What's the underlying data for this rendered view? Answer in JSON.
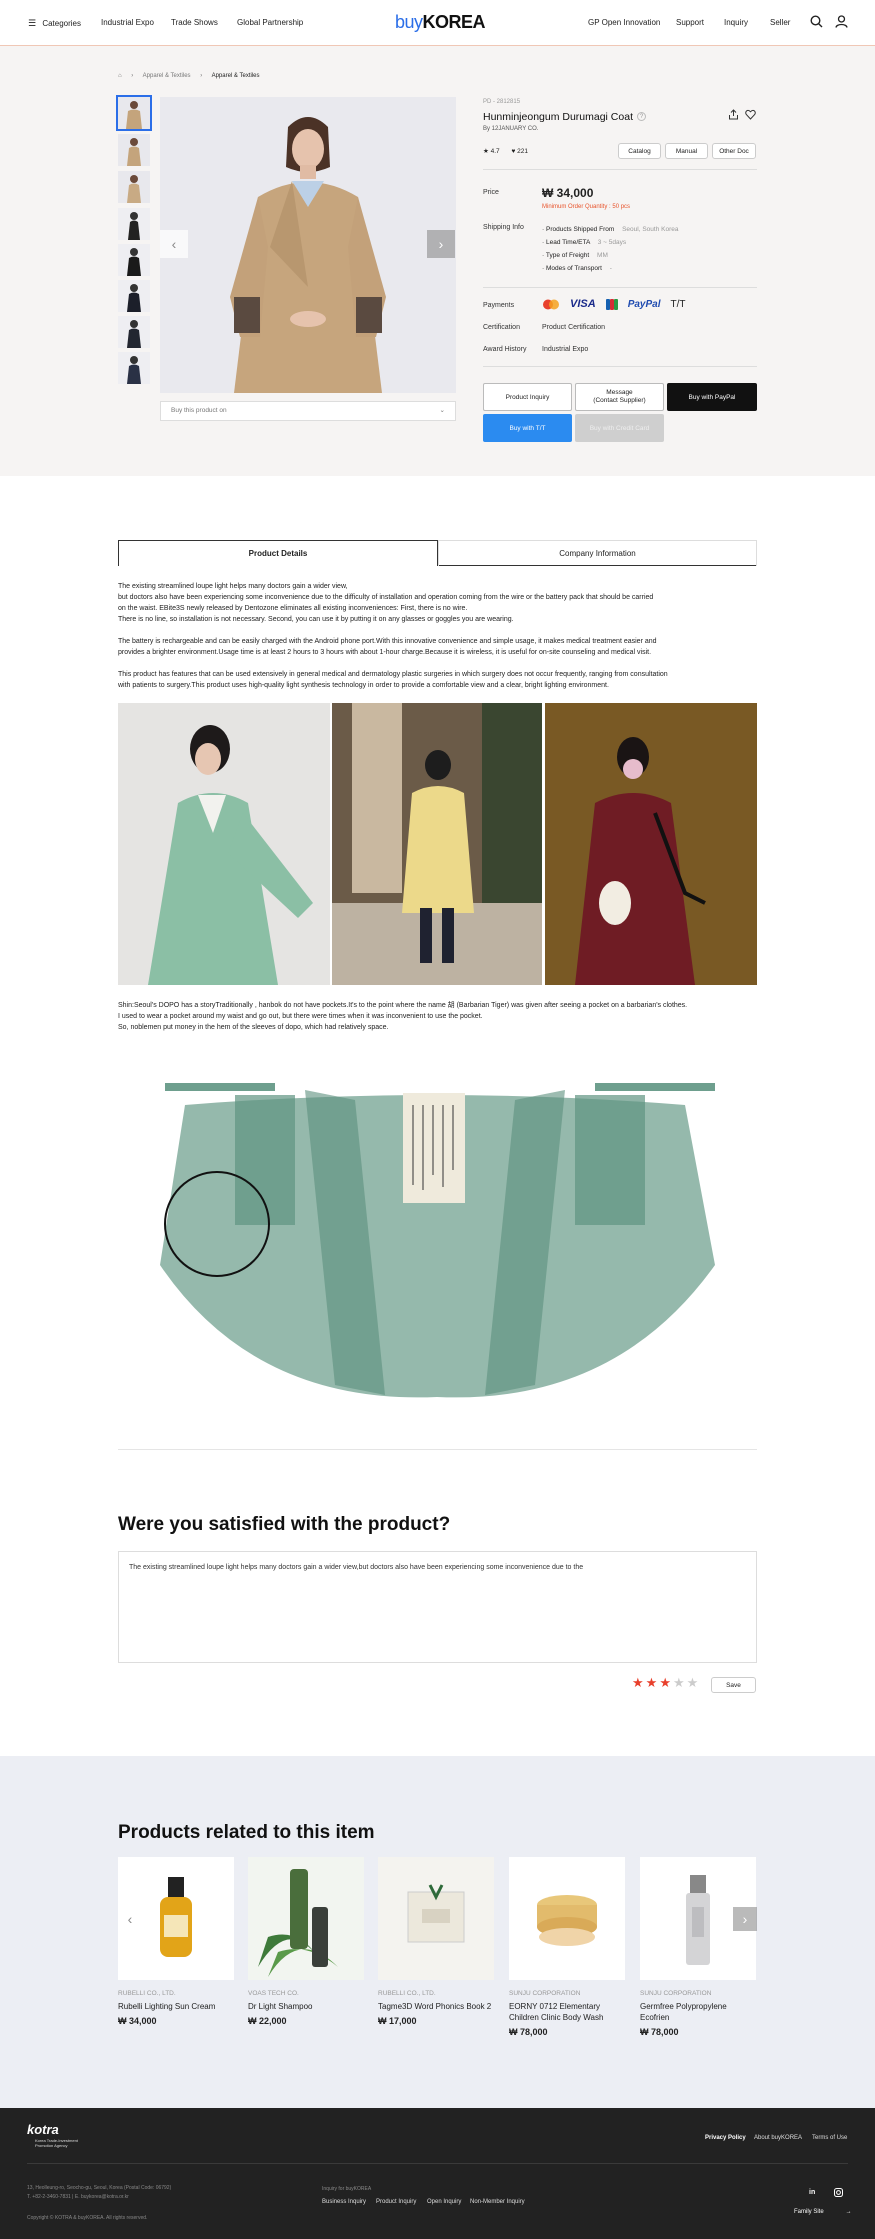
{
  "header": {
    "categories": "Categories",
    "nav": [
      "Industrial Expo",
      "Trade Shows",
      "Global Partnership"
    ],
    "logo_buy": "buy",
    "logo_korea": "KOREA",
    "right_nav": [
      "GP Open Innovation",
      "Support",
      "Inquiry",
      "Seller"
    ]
  },
  "breadcrumb": [
    "Apparel & Textiles",
    "Apparel & Textiles"
  ],
  "product": {
    "pid": "PD - 2812815",
    "name": "Hunminjeongum Durumagi Coat",
    "by": "By 12JANUARY CO.",
    "rating": "4.7",
    "likes": "221",
    "doc_buttons": [
      "Catalog",
      "Manual",
      "Other Doc"
    ],
    "price_label": "Price",
    "price": "₩ 34,000",
    "moq": "Minimum Order Quantity : 50 pcs",
    "shipping_label": "Shipping Info",
    "shipping": [
      {
        "k": "Products Shipped From",
        "v": "Seoul, South Korea"
      },
      {
        "k": "Lead Time/ETA",
        "v": "3 ~ 5days"
      },
      {
        "k": "Type of Freight",
        "v": "MM"
      },
      {
        "k": "Modes of Transport",
        "v": "-"
      }
    ],
    "payments_label": "Payments",
    "payments": {
      "visa": "VISA",
      "paypal": "PayPal",
      "tt": "T/T"
    },
    "cert_label": "Certification",
    "cert": "Product Certification",
    "award_label": "Award History",
    "award": "Industrial Expo",
    "buy_select": "Buy this product on",
    "actions": {
      "inquiry": "Product Inquiry",
      "message": "Message\n(Contact Supplier)",
      "paypal": "Buy with PayPal",
      "tt": "Buy with T/T",
      "card": "Buy with Credit Card"
    }
  },
  "tabs": [
    "Product Details",
    "Company Information"
  ],
  "description": {
    "p1": "The existing streamlined loupe light helps many doctors gain a wider view,\nbut doctors also have been experiencing some inconvenience due to the difficulty of installation and operation coming from the wire or the battery pack that should be carried\non the waist. EBite3S newly released by Dentozone eliminates all existing inconveniences: First, there is no wire.\nThere is no line, so installation is not necessary. Second, you can use it by putting it on any glasses or goggles you are wearing.",
    "p2": "The battery is rechargeable and can be easily charged with the Android phone port.With this innovative convenience and simple usage, it makes medical treatment easier and\nprovides a brighter environment.Usage time is at least 2 hours to 3 hours with about 1-hour charge.Because it is wireless, it is useful for on-site counseling and medical visit.",
    "p3": "This product has features that can be used extensively in general medical and dermatology plastic surgeries in which surgery does not occur frequently, ranging from consultation\nwith patients to surgery.This product uses high-quality light synthesis technology in order to provide a comfortable view and a clear, bright lighting environment.",
    "p4": "Shin:Seoul's DOPO has a storyTraditionally , hanbok do not have pockets.It's to the point where the name 胡 (Barbarian Tiger) was given after seeing a pocket on a barbarian's clothes.\nI used to wear a pocket around my waist and go out, but there were times when it was inconvenient to use the pocket.\nSo, noblemen put money in the hem of the sleeves of dopo, which had relatively space."
  },
  "review": {
    "title": "Were you satisfied with the product?",
    "text": "The existing streamlined loupe light helps many doctors gain a wider view,but doctors also have been experiencing some inconvenience due to the",
    "stars": 3,
    "save": "Save"
  },
  "related": {
    "title": "Products related to this item",
    "items": [
      {
        "company": "RUBELLI CO., LTD.",
        "name": "Rubelli Lighting Sun Cream",
        "price": "₩ 34,000"
      },
      {
        "company": "VOAS TECH CO.",
        "name": "Dr Light Shampoo",
        "price": "₩ 22,000"
      },
      {
        "company": "RUBELLI CO., LTD.",
        "name": "Tagme3D Word Phonics Book 2",
        "price": "₩ 17,000"
      },
      {
        "company": "SUNJU CORPORATION",
        "name": "EORNY 0712 Elementary Children Clinic Body Wash",
        "price": "₩ 78,000"
      },
      {
        "company": "SUNJU CORPORATION",
        "name": "Germfree Polypropylene Ecofrien",
        "price": "₩ 78,000"
      }
    ]
  },
  "footer": {
    "logo": "kotra",
    "logo_sub": "Korea Trade-Investment\nPromotion Agency",
    "links": [
      "Privacy Policy",
      "About buyKOREA",
      "Terms of Use"
    ],
    "address": "13, Heolleung-ro, Seocho-gu, Seoul, Korea (Postal Code: 06792)",
    "contact": "T. +82-2-3460-7831 | E. buykorea@kotra.or.kr",
    "copyright": "Copyright © KOTRA & buyKOREA. All rights reserved.",
    "inquiry_label": "Inquiry for buyKOREA",
    "inquiry_links": [
      "Business Inquiry",
      "Product Inquiry",
      "Open Inquiry",
      "Non-Member Inquiry"
    ],
    "family_site": "Family Site"
  },
  "colors": {
    "accent": "#2b6ee8",
    "moq": "#e8542c",
    "star": "#e8402c",
    "footer": "#222222"
  }
}
